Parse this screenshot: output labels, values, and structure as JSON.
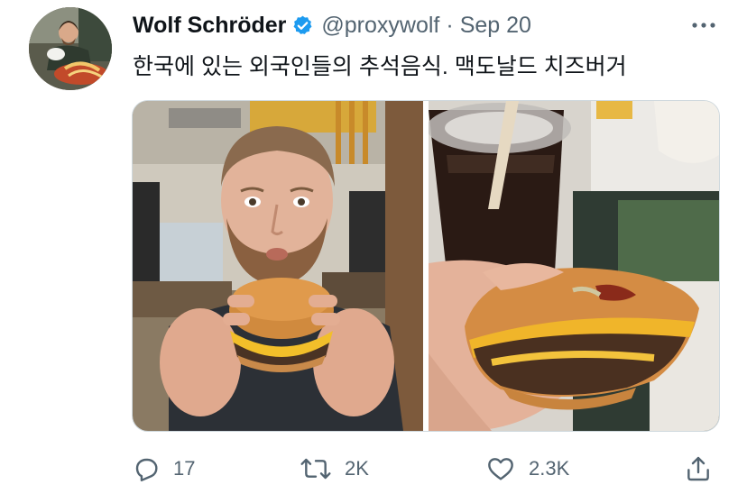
{
  "author": {
    "display_name": "Wolf Schröder",
    "handle": "@proxywolf",
    "separator": "·",
    "date": "Sep 20",
    "verified": true
  },
  "tweet": {
    "text": "한국에 있는 외국인들의 추석음식. 맥도날드 치즈버거"
  },
  "media": {
    "count": 2
  },
  "actions": {
    "reply_count": "17",
    "retweet_count": "2K",
    "like_count": "2.3K"
  },
  "icons": {
    "verified": "verified-badge-icon",
    "more": "more-options-icon",
    "reply": "reply-icon",
    "retweet": "retweet-icon",
    "like": "heart-icon",
    "share": "share-icon"
  },
  "colors": {
    "verified_blue": "#1d9bf0",
    "secondary_text": "#536471",
    "primary_text": "#0f1419",
    "border": "#cfd9de"
  }
}
